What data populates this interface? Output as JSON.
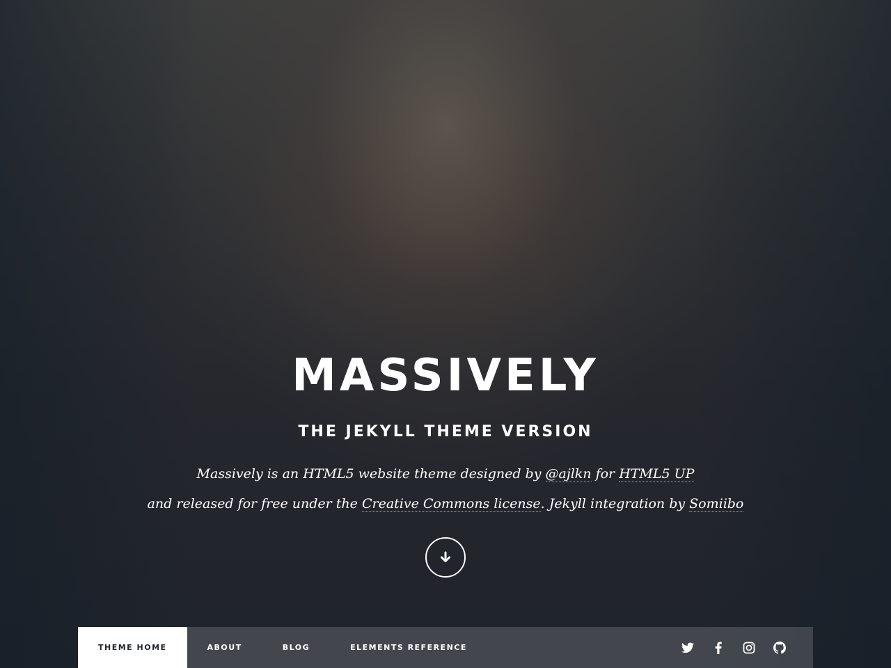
{
  "header": {
    "title": "MASSIVELY",
    "subtitle": "THE JEKYLL THEME VERSION"
  },
  "intro": {
    "line1": {
      "prefix": "Massively is an HTML5 website theme designed by ",
      "link_author": "@ajlkn",
      "middle": " for ",
      "link_html5up": "HTML5 UP"
    },
    "line2": {
      "prefix": "and released for free under the ",
      "link_license": "Creative Commons license",
      "middle": ". Jekyll integration by ",
      "link_somiibo": "Somiibo"
    },
    "scroll_icon": "arrow-down-icon"
  },
  "nav": {
    "items": [
      {
        "label": "THEME HOME",
        "active": true
      },
      {
        "label": "ABOUT",
        "active": false
      },
      {
        "label": "BLOG",
        "active": false
      },
      {
        "label": "ELEMENTS REFERENCE",
        "active": false
      }
    ],
    "icons": [
      "twitter-icon",
      "facebook-icon",
      "instagram-icon",
      "github-icon"
    ]
  },
  "colors": {
    "text": "#ffffff",
    "nav_active_bg": "#ffffff",
    "nav_active_text": "#1e252d"
  }
}
